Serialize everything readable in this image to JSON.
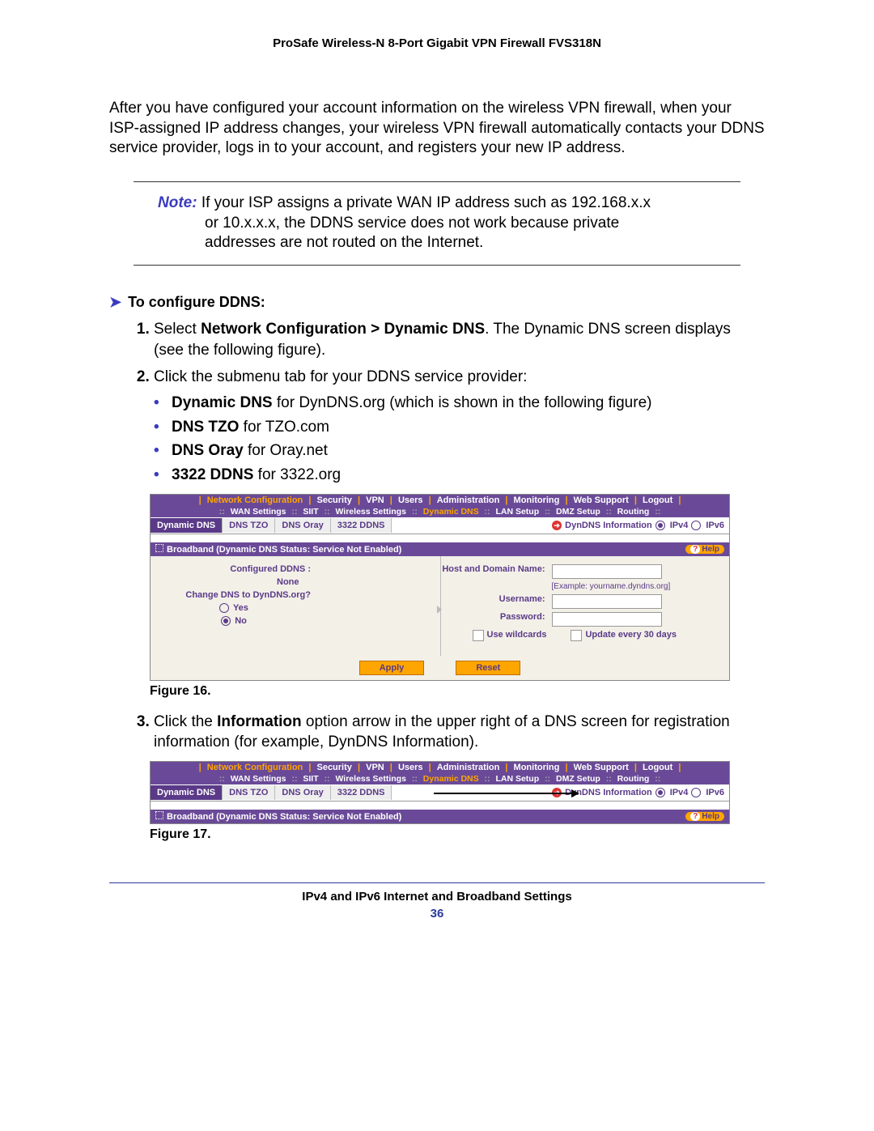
{
  "doc_title": "ProSafe Wireless-N 8-Port Gigabit VPN Firewall FVS318N",
  "intro_para": "After you have configured your account information on the wireless VPN firewall, when your ISP-assigned IP address changes, your wireless VPN firewall automatically contacts your DDNS service provider, logs in to your account, and registers your new IP address.",
  "note": {
    "label": "Note:",
    "line1": "If your ISP assigns a private WAN IP address such as 192.168.x.x",
    "line2": "or 10.x.x.x, the DDNS service does not work because private",
    "line3": "addresses are not routed on the Internet."
  },
  "heading": "To configure DDNS:",
  "steps": {
    "s1a": "Select ",
    "s1b": "Network Configuration > Dynamic DNS",
    "s1c": ". The Dynamic DNS screen displays (see the following figure).",
    "s2": "Click the submenu tab for your DDNS service provider:",
    "b1a": "Dynamic DNS",
    "b1b": " for DynDNS.org (which is shown in the following figure)",
    "b2a": "DNS TZO",
    "b2b": " for TZO.com",
    "b3a": "DNS Oray",
    "b3b": " for Oray.net",
    "b4a": "3322 DDNS",
    "b4b": " for 3322.org",
    "s3a": "Click the ",
    "s3b": "Information",
    "s3c": " option arrow in the upper right of a DNS screen for registration information (for example, DynDNS Information)."
  },
  "fig16_caption": "Figure 16.",
  "fig17_caption": "Figure 17.",
  "ui": {
    "topnav": [
      "Network Configuration",
      "Security",
      "VPN",
      "Users",
      "Administration",
      "Monitoring",
      "Web Support",
      "Logout"
    ],
    "subnav": [
      "WAN Settings",
      "SIIT",
      "Wireless Settings",
      "Dynamic DNS",
      "LAN Setup",
      "DMZ Setup",
      "Routing"
    ],
    "tabs": [
      "Dynamic DNS",
      "DNS TZO",
      "DNS Oray",
      "3322 DDNS"
    ],
    "info_label": "DynDNS Information",
    "ipv4": "IPv4",
    "ipv6": "IPv6",
    "panel_title": "Broadband (Dynamic DNS Status: Service Not Enabled)",
    "help": "Help",
    "left": {
      "l1": "Configured DDNS :",
      "v1": "None",
      "l2": "Change DNS to DynDNS.org?",
      "yes": "Yes",
      "no": "No"
    },
    "right": {
      "l1": "Host and Domain Name:",
      "ex": "[Example: yourname.dyndns.org]",
      "l2": "Username:",
      "l3": "Password:",
      "cb1": "Use wildcards",
      "cb2": "Update every 30 days"
    },
    "apply": "Apply",
    "reset": "Reset"
  },
  "footer": {
    "text": "IPv4 and IPv6 Internet and Broadband Settings",
    "page": "36"
  }
}
